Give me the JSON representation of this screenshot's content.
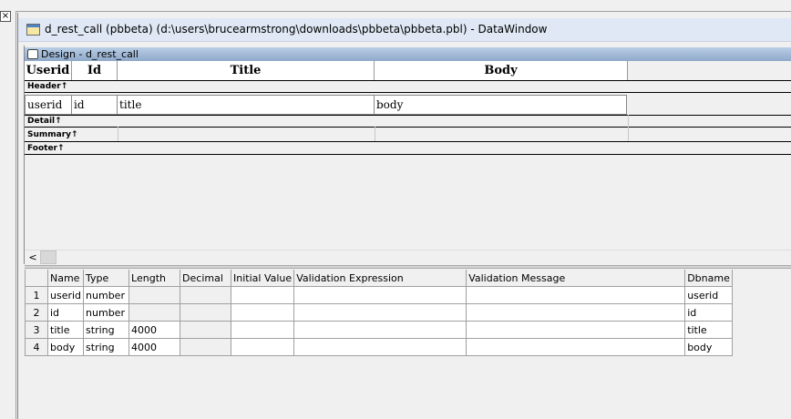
{
  "window": {
    "close_glyph": "×",
    "title": "d_rest_call  (pbbeta) (d:\\users\\brucearmstrong\\downloads\\pbbeta\\pbbeta.pbl) - DataWindow"
  },
  "design": {
    "pane_title": "Design - d_rest_call",
    "columns": [
      {
        "heading": "Userid"
      },
      {
        "heading": "Id"
      },
      {
        "heading": "Title"
      },
      {
        "heading": "Body"
      }
    ],
    "bands": {
      "header": "Header↑",
      "detail": "Detail↑",
      "summary": "Summary↑",
      "footer": "Footer↑"
    },
    "detail_fields": [
      "userid",
      "id",
      "title",
      "body"
    ],
    "scroll_left_glyph": "<"
  },
  "column_spec": {
    "headers": [
      "",
      "Name",
      "Type",
      "Length",
      "Decimal",
      "Initial Value",
      "Validation Expression",
      "Validation Message",
      "Dbname"
    ],
    "rows": [
      {
        "num": "1",
        "name": "userid",
        "type": "number",
        "length": "",
        "decimal": "",
        "initial": "",
        "valexp": "",
        "valmsg": "",
        "dbname": "userid"
      },
      {
        "num": "2",
        "name": "id",
        "type": "number",
        "length": "",
        "decimal": "",
        "initial": "",
        "valexp": "",
        "valmsg": "",
        "dbname": "id"
      },
      {
        "num": "3",
        "name": "title",
        "type": "string",
        "length": "4000",
        "decimal": "",
        "initial": "",
        "valexp": "",
        "valmsg": "",
        "dbname": "title"
      },
      {
        "num": "4",
        "name": "body",
        "type": "string",
        "length": "4000",
        "decimal": "",
        "initial": "",
        "valexp": "",
        "valmsg": "",
        "dbname": "body"
      }
    ]
  }
}
